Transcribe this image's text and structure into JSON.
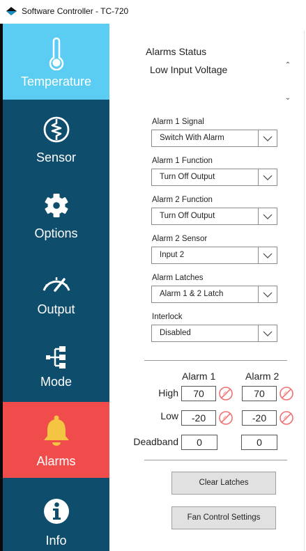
{
  "window": {
    "title": "Software Controller - TC-720"
  },
  "sidebar": {
    "items": [
      {
        "label": "Temperature",
        "icon": "thermometer-icon",
        "active": true
      },
      {
        "label": "Sensor",
        "icon": "sensor-coil-icon"
      },
      {
        "label": "Options",
        "icon": "gear-icon"
      },
      {
        "label": "Output",
        "icon": "gauge-icon"
      },
      {
        "label": "Mode",
        "icon": "mode-tree-icon"
      },
      {
        "label": "Alarms",
        "icon": "bell-icon",
        "selected": true
      },
      {
        "label": "Info",
        "icon": "info-icon"
      }
    ],
    "colors": {
      "background": "#0e4d6b",
      "temperature": "#5bcdf3",
      "alarms": "#f14c4c",
      "bell": "#f4c542"
    }
  },
  "alarms_status": {
    "title": "Alarms Status",
    "items": [
      "Low Input Voltage"
    ]
  },
  "fields": [
    {
      "label": "Alarm 1 Signal",
      "value": "Switch With Alarm"
    },
    {
      "label": "Alarm 1 Function",
      "value": "Turn Off Output"
    },
    {
      "label": "Alarm 2 Function",
      "value": "Turn Off Output"
    },
    {
      "label": "Alarm 2 Sensor",
      "value": "Input 2"
    },
    {
      "label": "Alarm Latches",
      "value": "Alarm 1 & 2 Latch"
    },
    {
      "label": "Interlock",
      "value": "Disabled"
    }
  ],
  "thresholds": {
    "col1": "Alarm 1",
    "col2": "Alarm 2",
    "high_label": "High",
    "low_label": "Low",
    "deadband_label": "Deadband",
    "alarm1": {
      "high": "70",
      "low": "-20",
      "deadband": "0"
    },
    "alarm2": {
      "high": "70",
      "low": "-20",
      "deadband": "0"
    }
  },
  "buttons": {
    "clear_latches": "Clear Latches",
    "fan_control": "Fan Control Settings"
  }
}
